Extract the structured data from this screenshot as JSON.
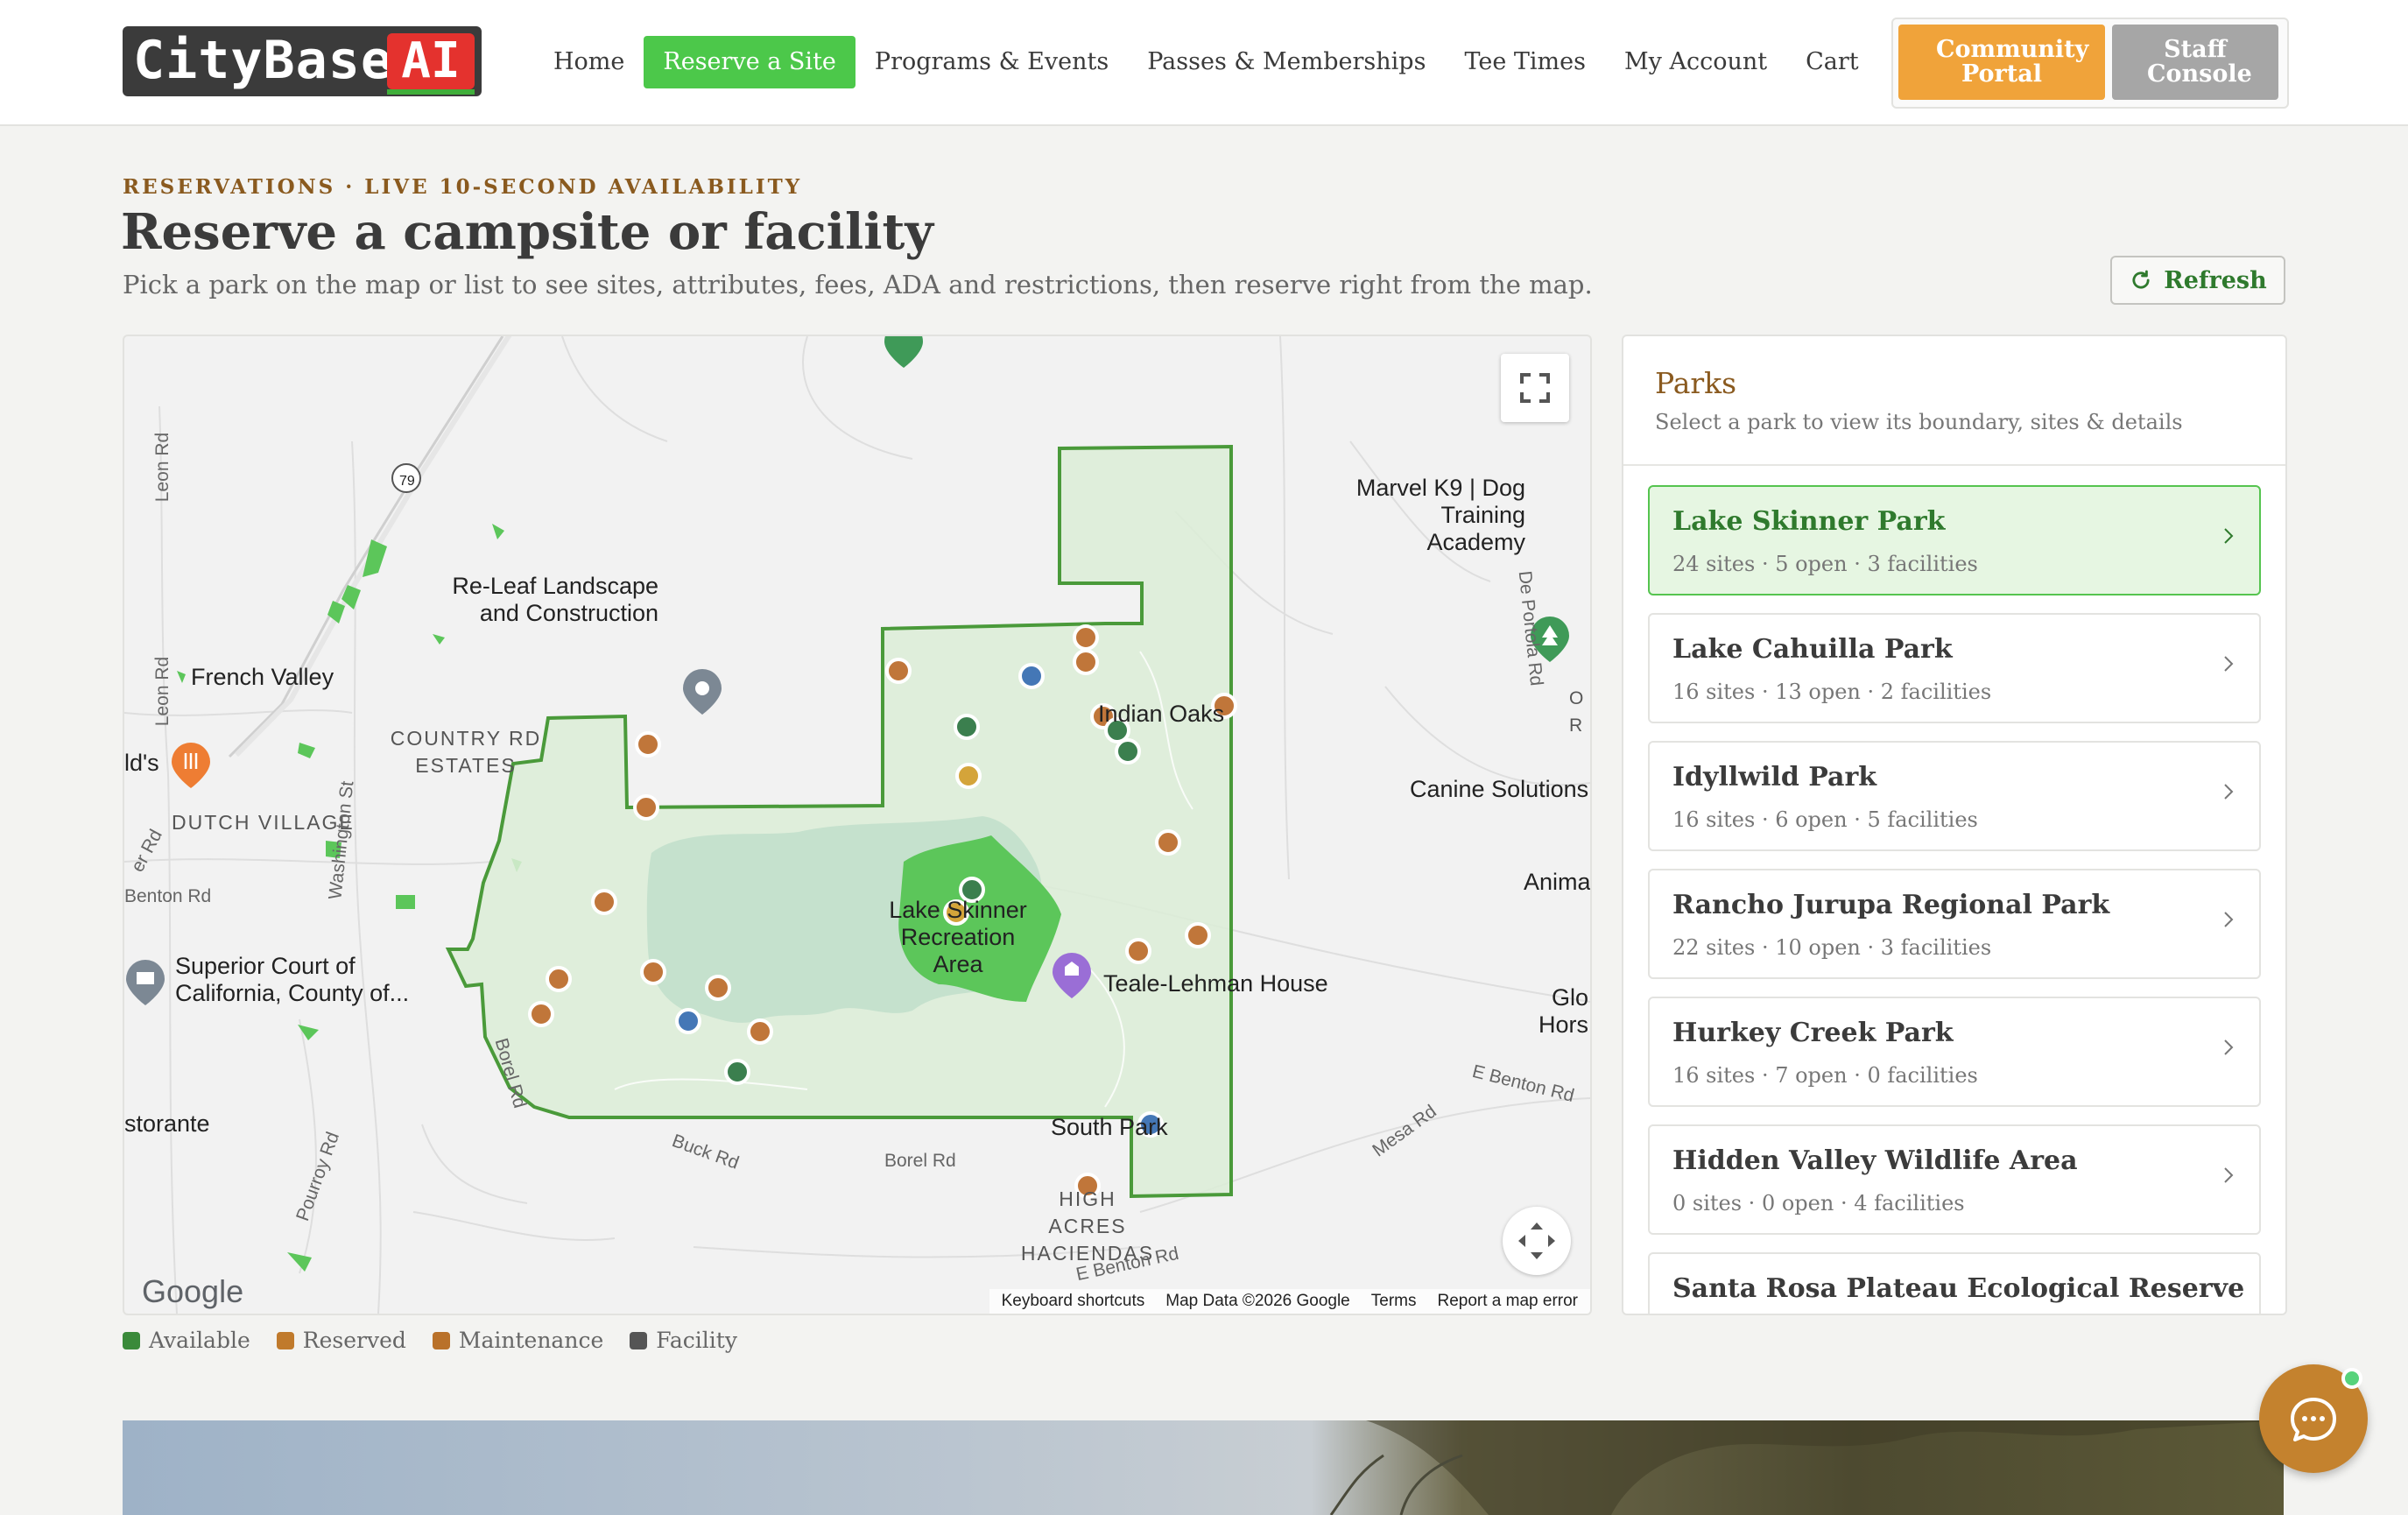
{
  "brand": {
    "name": "CityBase",
    "suffix": "AI"
  },
  "nav": {
    "items": [
      {
        "label": "Home",
        "active": false
      },
      {
        "label": "Reserve a Site",
        "active": true
      },
      {
        "label": "Programs & Events",
        "active": false
      },
      {
        "label": "Passes & Memberships",
        "active": false
      },
      {
        "label": "Tee Times",
        "active": false
      },
      {
        "label": "My Account",
        "active": false
      },
      {
        "label": "Cart",
        "active": false
      }
    ],
    "community_portal": "Community Portal",
    "staff_console": "Staff Console"
  },
  "page": {
    "eyebrow": "RESERVATIONS · LIVE 10-SECOND AVAILABILITY",
    "title": "Reserve a campsite or facility",
    "subtitle": "Pick a park on the map or list to see sites, attributes, fees, ADA and restrictions, then reserve right from the map.",
    "refresh_label": "Refresh"
  },
  "map": {
    "labels": {
      "releaf": "Re-Leaf Landscape and Construction",
      "marvel": "Marvel K9 | Dog Training Academy",
      "french_valley": "French Valley",
      "country_rd": "COUNTRY RD ESTATES",
      "dutch_village": "DUTCH VILLAGE",
      "lds": "ld's",
      "canine": "Canine Solutions",
      "anima": "Anima",
      "glo": "Glo Hors",
      "indian_oaks": "Indian Oaks",
      "lake_skinner": "Lake Skinner Recreation Area",
      "teale": "Teale-Lehman House",
      "superior_court": "Superior Court of California, County of...",
      "storante": "storante",
      "south_park": "South Park",
      "high_acres": "HIGH ACRES HACIENDAS",
      "o_r": "O R"
    },
    "roads": {
      "leon_rd": "Leon Rd",
      "leon_rd_2": "Leon Rd",
      "route_79": "79",
      "washington_st": "Washington St",
      "de_portola_rd": "De Portola Rd",
      "benton_rd_w": "Benton Rd",
      "er_rd": "er Rd",
      "borel_rd": "Borel Rd",
      "borel_rd_2": "Borel Rd",
      "buck_rd": "Buck Rd",
      "pourroy_rd": "Pourroy Rd",
      "mesa_rd": "Mesa Rd",
      "e_benton_rd": "E Benton Rd",
      "e_benton_rd_2": "E Benton Rd"
    },
    "google": "Google",
    "attribution": [
      "Keyboard shortcuts",
      "Map Data ©2026 Google",
      "Terms",
      "Report a map error"
    ]
  },
  "legend": [
    {
      "label": "Available",
      "color": "#3a8a3a"
    },
    {
      "label": "Reserved",
      "color": "#c07a2c"
    },
    {
      "label": "Maintenance",
      "color": "#b9712a"
    },
    {
      "label": "Facility",
      "color": "#555555"
    }
  ],
  "parks_panel": {
    "title": "Parks",
    "subtitle": "Select a park to view its boundary, sites & details",
    "parks": [
      {
        "name": "Lake Skinner Park",
        "meta": "24 sites · 5 open · 3 facilities",
        "selected": true
      },
      {
        "name": "Lake Cahuilla Park",
        "meta": "16 sites · 13 open · 2 facilities",
        "selected": false
      },
      {
        "name": "Idyllwild Park",
        "meta": "16 sites · 6 open · 5 facilities",
        "selected": false
      },
      {
        "name": "Rancho Jurupa Regional Park",
        "meta": "22 sites · 10 open · 3 facilities",
        "selected": false
      },
      {
        "name": "Hurkey Creek Park",
        "meta": "16 sites · 7 open · 0 facilities",
        "selected": false
      },
      {
        "name": "Hidden Valley Wildlife Area",
        "meta": "0 sites · 0 open · 4 facilities",
        "selected": false
      },
      {
        "name": "Santa Rosa Plateau Ecological Reserve",
        "meta": "",
        "selected": false
      }
    ]
  },
  "colors": {
    "accent_green": "#4cc84a",
    "brand_orange": "#f0a33a",
    "site_reserved": "#c0763a",
    "site_available": "#3b7f4e",
    "site_blue": "#4477b6",
    "site_yellow": "#d4a43a",
    "park_boundary": "#4a9a3a"
  }
}
